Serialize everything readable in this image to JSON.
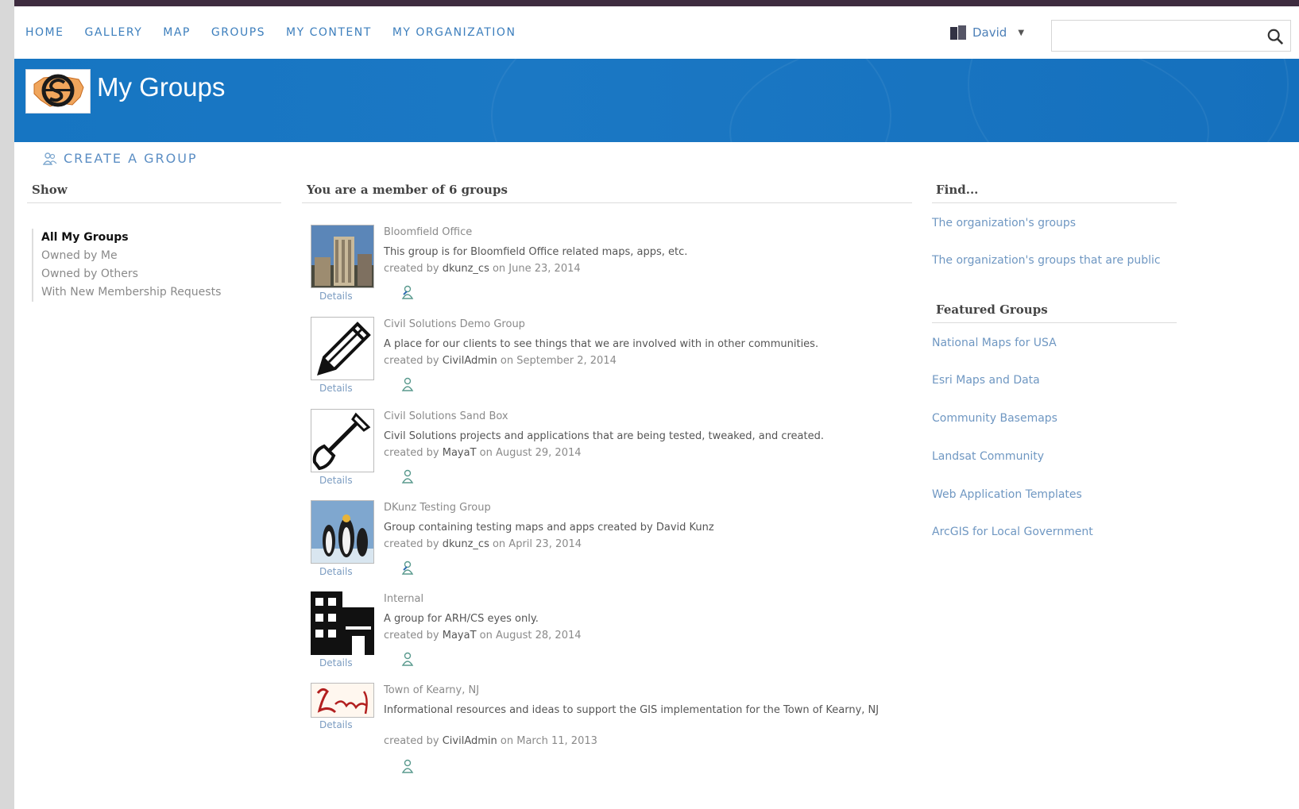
{
  "nav": {
    "links": [
      "HOME",
      "GALLERY",
      "MAP",
      "GROUPS",
      "MY CONTENT",
      "MY ORGANIZATION"
    ],
    "user": "David",
    "search_placeholder": ""
  },
  "banner": {
    "title": "My Groups"
  },
  "create_group_label": "CREATE A GROUP",
  "show": {
    "heading": "Show",
    "items": [
      "All My Groups",
      "Owned by Me",
      "Owned by Others",
      "With New Membership Requests"
    ]
  },
  "groups_heading": "You are a member of 6 groups",
  "groups": [
    {
      "title": "Bloomfield Office",
      "desc": "This group is for Bloomfield Office related maps, apps, etc.",
      "created_prefix": "created by ",
      "owner": "dkunz_cs",
      "date": " on June 23, 2014",
      "details": "Details"
    },
    {
      "title": "Civil Solutions Demo Group",
      "desc": "A place for our clients to see things that we are involved with in other communities.",
      "created_prefix": "created by ",
      "owner": "CivilAdmin",
      "date": " on September 2, 2014",
      "details": "Details"
    },
    {
      "title": "Civil Solutions Sand Box",
      "desc": "Civil Solutions projects and applications that are being tested, tweaked, and created.",
      "created_prefix": "created by ",
      "owner": "MayaT",
      "date": " on August 29, 2014",
      "details": "Details"
    },
    {
      "title": "DKunz Testing Group",
      "desc": "Group containing testing maps and apps created by David Kunz",
      "created_prefix": "created by ",
      "owner": "dkunz_cs",
      "date": " on April 23, 2014",
      "details": "Details"
    },
    {
      "title": "Internal",
      "desc": "A group for ARH/CS eyes only.",
      "created_prefix": "created by ",
      "owner": "MayaT",
      "date": " on August 28, 2014",
      "details": "Details"
    },
    {
      "title": "Town of Kearny, NJ",
      "desc": "Informational resources and ideas to support the GIS implementation for the Town of Kearny, NJ",
      "created_prefix": "created by ",
      "owner": "CivilAdmin",
      "date": " on March 11, 2013",
      "details": "Details"
    }
  ],
  "find": {
    "heading": "Find...",
    "links": [
      "The organization's groups",
      "The organization's groups that are public"
    ]
  },
  "featured": {
    "heading": "Featured Groups",
    "links": [
      "National Maps for USA",
      "Esri Maps and Data",
      "Community Basemaps",
      "Landsat Community",
      "Web Application Templates",
      "ArcGIS for Local Government"
    ]
  },
  "colors": {
    "banner": "#1675c2",
    "link": "#3d7fbd"
  }
}
